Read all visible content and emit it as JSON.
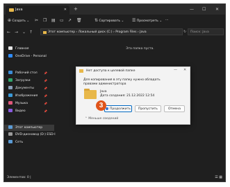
{
  "window": {
    "tab_title": "Java",
    "tab_close": "✕",
    "new_tab": "+",
    "minimize": "—",
    "maximize": "☐",
    "close": "✕"
  },
  "toolbar": {
    "create_label": "Создать",
    "sort_label": "Сортировать",
    "view_label": "Просмотреть",
    "more": "···"
  },
  "address": {
    "path": "Этот компьютер  ›  Локальный диск (C:)  ›  Program Files  ›  Java",
    "search_placeholder": "Поиск: Java"
  },
  "sidebar": {
    "items": [
      {
        "label": "Главная",
        "icon": "home-icon",
        "color": "#e6e6e6"
      },
      {
        "label": "OneDrive - Personal",
        "icon": "onedrive-icon",
        "color": "#2f8cff"
      },
      {
        "label": "Рабочий стол",
        "icon": "desktop-icon",
        "color": "#3b8cd6"
      },
      {
        "label": "Загрузки",
        "icon": "downloads-icon",
        "color": "#2fa36a"
      },
      {
        "label": "Документы",
        "icon": "documents-icon",
        "color": "#8aa0b8"
      },
      {
        "label": "Изображения",
        "icon": "pictures-icon",
        "color": "#3a9ad9"
      },
      {
        "label": "Музыка",
        "icon": "music-icon",
        "color": "#e0577a"
      },
      {
        "label": "Видео",
        "icon": "videos-icon",
        "color": "#8a5be0"
      },
      {
        "label": "Этот компьютер",
        "icon": "computer-icon",
        "color": "#5b9bd5"
      },
      {
        "label": "DVD-дисковод (D:) ESD-I",
        "icon": "dvd-icon",
        "color": "#9a9a9a"
      },
      {
        "label": "Сеть",
        "icon": "network-icon",
        "color": "#5b9bd5"
      }
    ]
  },
  "content": {
    "empty_text": "Эта папка пуста."
  },
  "status": {
    "count_text": "Элементов: 0",
    "divider": "|"
  },
  "dialog": {
    "title": "Нет доступа к целевой папке",
    "message": "Для копирования в эту папку нужно обладать правами администратора",
    "folder_name": "Java",
    "folder_date": "Дата создания: 21.12.2022 12:54",
    "continue_label": "Продолжить",
    "skip_label": "Пропустить",
    "cancel_label": "Отмена",
    "details_label": "Меньше сведений",
    "minimize": "—",
    "close": "✕"
  },
  "annotation": {
    "step_number": "3",
    "color": "#e0541a"
  }
}
